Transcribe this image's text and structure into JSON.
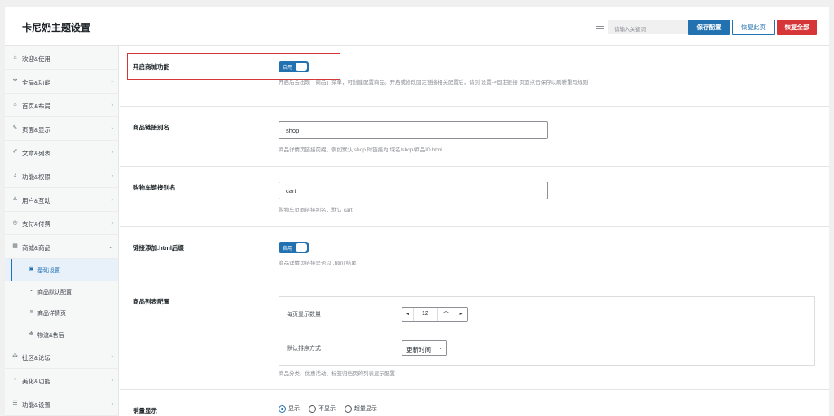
{
  "header": {
    "title": "卡尼奶主题设置",
    "search_placeholder": "请输入关键词",
    "save_label": "保存配置",
    "reset_page_label": "恢复此页",
    "reset_all_label": "恢复全部"
  },
  "sidebar": {
    "items": [
      {
        "label": "欢迎&使用",
        "icon": "home-icon",
        "has_arrow": false
      },
      {
        "label": "全局&功能",
        "icon": "gear-icon",
        "has_arrow": true
      },
      {
        "label": "首页&布局",
        "icon": "house-icon",
        "has_arrow": true
      },
      {
        "label": "页面&显示",
        "icon": "brush-icon",
        "has_arrow": true
      },
      {
        "label": "文章&列表",
        "icon": "pencil-icon",
        "has_arrow": true
      },
      {
        "label": "功能&权限",
        "icon": "key-icon",
        "has_arrow": true
      },
      {
        "label": "用户&互动",
        "icon": "user-icon",
        "has_arrow": true
      },
      {
        "label": "支付&付费",
        "icon": "coin-icon",
        "has_arrow": true
      },
      {
        "label": "商城&商品",
        "icon": "shop-icon",
        "has_arrow": true,
        "expanded": true
      }
    ],
    "sub_items": [
      {
        "label": "基础设置",
        "icon": "grid-icon",
        "active": true
      },
      {
        "label": "商品默认配置",
        "icon": "box-icon",
        "active": false
      },
      {
        "label": "商品详情页",
        "icon": "file-icon",
        "active": false
      },
      {
        "label": "物流&售后",
        "icon": "truck-icon",
        "active": false
      }
    ],
    "items_after": [
      {
        "label": "社区&论坛",
        "icon": "community-icon",
        "has_arrow": true
      },
      {
        "label": "美化&功能",
        "icon": "magic-icon",
        "has_arrow": true
      },
      {
        "label": "功能&设置",
        "icon": "list-icon",
        "has_arrow": true
      }
    ]
  },
  "settings": {
    "shop_enable": {
      "label": "开启商城功能",
      "toggle_label": "启用",
      "enabled": true,
      "desc": "开启后会出现「商品」菜单，可创建配置商品。开启或修改固定链接相关配置后，请到 设置->固定链接 页面点击保存以刷新重写规则"
    },
    "product_slug": {
      "label": "商品链接别名",
      "value": "shop",
      "desc": "商品详情页链接前缀，例如默认 shop 时链接为 域名/shop/商品ID.html"
    },
    "cart_slug": {
      "label": "购物车链接别名",
      "value": "cart",
      "desc": "购物车页面链接别名，默认 cart"
    },
    "html_suffix": {
      "label": "链接添加.html后缀",
      "toggle_label": "启用",
      "enabled": true,
      "desc": "商品详情页链接是否以 .html 结尾"
    },
    "list_config": {
      "label": "商品列表配置",
      "per_page_label": "每页显示数量",
      "per_page_value": "12",
      "per_page_up": "个",
      "sort_label": "默认排序方式",
      "sort_value": "更新时间",
      "desc": "商品分类、优惠活动、标签归档页的列表显示配置"
    },
    "sales_display": {
      "label": "销量显示",
      "options": [
        "显示",
        "不显示",
        "超量显示"
      ],
      "selected": "显示"
    }
  },
  "colors": {
    "accent": "#2271b1",
    "danger": "#d63638",
    "highlight_border": "#d63638"
  }
}
